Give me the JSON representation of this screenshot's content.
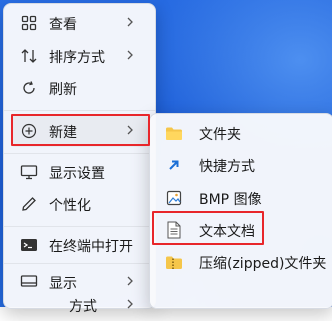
{
  "main_menu": {
    "items": [
      {
        "label": "查看",
        "icon": "grid-icon"
      },
      {
        "label": "排序方式",
        "icon": "sort-icon"
      },
      {
        "label": "刷新",
        "icon": "refresh-icon"
      },
      {
        "label": "新建",
        "icon": "plus-circle-icon"
      },
      {
        "label": "显示设置",
        "icon": "monitor-icon"
      },
      {
        "label": "个性化",
        "icon": "pen-icon"
      },
      {
        "label": "在终端中打开",
        "icon": "terminal-icon"
      },
      {
        "label": "显示",
        "icon": "screen-icon"
      },
      {
        "label": "方式",
        "icon": ""
      }
    ]
  },
  "sub_menu": {
    "items": [
      {
        "label": "文件夹",
        "icon": "folder-icon"
      },
      {
        "label": "快捷方式",
        "icon": "shortcut-icon"
      },
      {
        "label": "BMP 图像",
        "icon": "image-icon"
      },
      {
        "label": "文本文档",
        "icon": "text-document-icon"
      },
      {
        "label": "压缩(zipped)文件夹",
        "icon": "zip-folder-icon"
      }
    ]
  },
  "colors": {
    "highlight_border": "#e8262a",
    "accent": "#1e5fd8"
  }
}
